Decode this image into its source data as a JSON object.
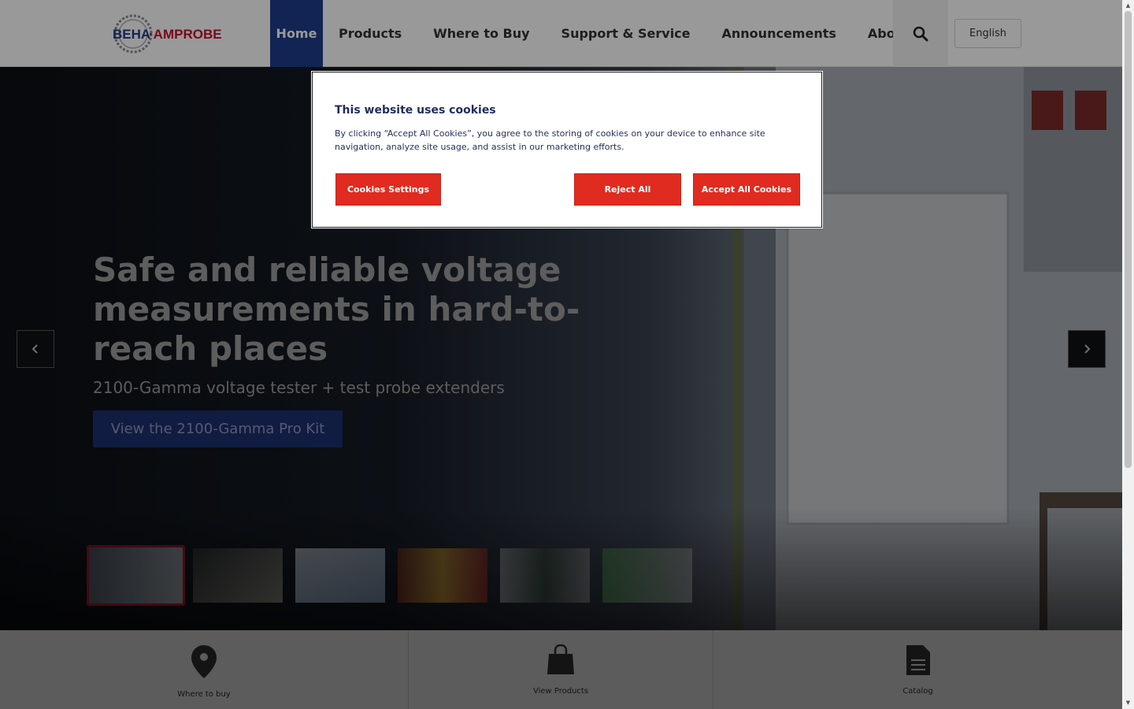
{
  "header": {
    "logo_text": "BEHA·AMPROBE",
    "nav": [
      {
        "label": "Home"
      },
      {
        "label": "Products"
      },
      {
        "label": "Where to Buy"
      },
      {
        "label": "Support & Service"
      },
      {
        "label": "Announcements"
      },
      {
        "label": "About Us"
      }
    ],
    "search_icon": "search-icon",
    "language": "English"
  },
  "hero": {
    "title": "Safe and reliable voltage measurements in hard-to-reach places",
    "subtitle": "2100-Gamma voltage tester + test probe extenders",
    "cta": "View the 2100-Gamma Pro Kit",
    "prev_icon": "chevron-left-icon",
    "next_icon": "chevron-right-icon",
    "thumbnail_count": 6,
    "active_thumbnail": 1
  },
  "bottom_bar": {
    "items": [
      {
        "label": "Where to buy",
        "icon": "map-pin-icon"
      },
      {
        "label": "View Products",
        "icon": "shopping-bag-icon"
      },
      {
        "label": "Catalog",
        "icon": "document-icon"
      }
    ]
  },
  "cookie_modal": {
    "title": "This website uses cookies",
    "text": "By clicking “Accept All Cookies”, you agree to the storing of cookies on your device to enhance site navigation, analyze site usage, and assist in our marketing efforts.",
    "settings_label": "Cookies Settings",
    "reject_label": "Reject All",
    "accept_label": "Accept All Cookies"
  },
  "colors": {
    "brand_blue": "#1f3d8c",
    "brand_red": "#e02b20",
    "modal_text": "#1f2d5c"
  }
}
